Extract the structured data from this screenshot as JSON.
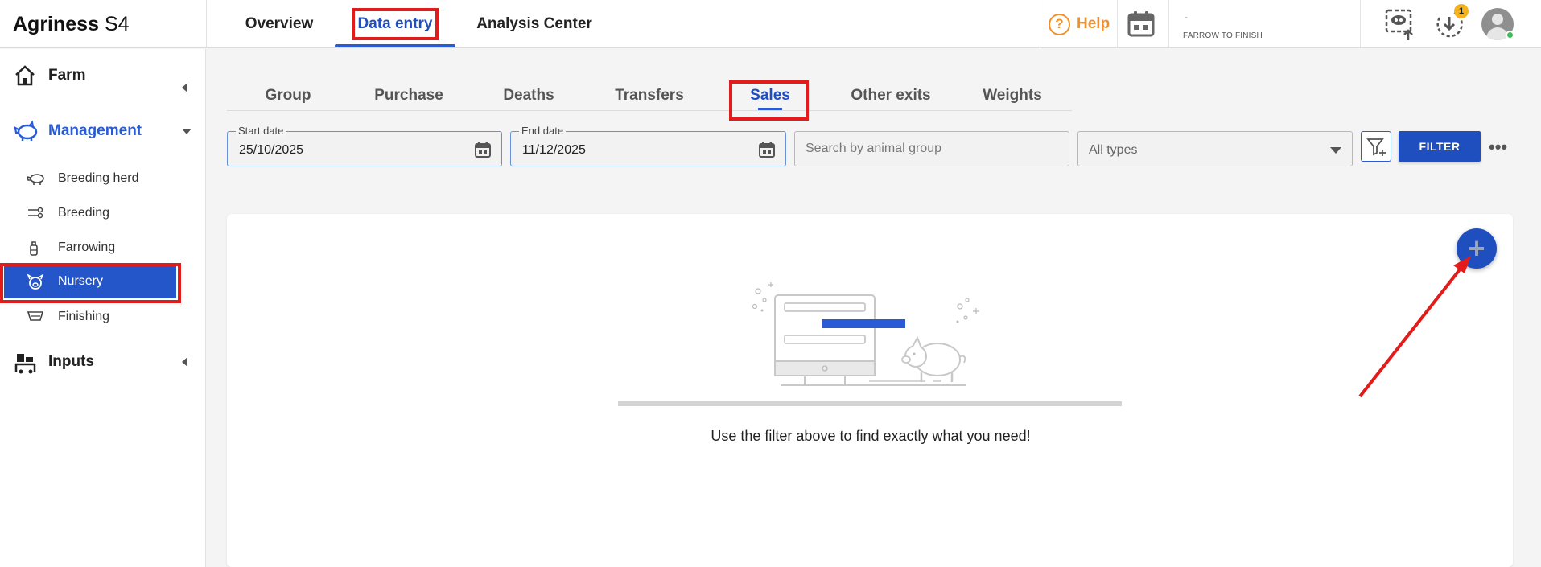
{
  "header": {
    "brand_name": "Agriness",
    "brand_version": "S4",
    "nav": [
      {
        "label": "Overview"
      },
      {
        "label": "Data entry"
      },
      {
        "label": "Analysis Center"
      }
    ],
    "help_label": "Help",
    "farm_name": "-",
    "farm_mode": "FARROW TO FINISH",
    "notification_count": "1",
    "icons": [
      "help-icon",
      "calendar-icon",
      "screen-share-icon",
      "download-icon",
      "avatar"
    ]
  },
  "sidebar": {
    "sections": [
      {
        "label": "Farm",
        "icon": "home-icon"
      },
      {
        "label": "Management",
        "icon": "pig-icon"
      },
      {
        "label": "Inputs",
        "icon": "cart-icon"
      }
    ],
    "items": [
      {
        "label": "Breeding herd",
        "icon": "sow-icon"
      },
      {
        "label": "Breeding",
        "icon": "breeding-icon"
      },
      {
        "label": "Farrowing",
        "icon": "bottle-icon"
      },
      {
        "label": "Nursery",
        "icon": "piglet-icon"
      },
      {
        "label": "Finishing",
        "icon": "feeder-icon"
      }
    ]
  },
  "subtabs": [
    {
      "label": "Group"
    },
    {
      "label": "Purchase"
    },
    {
      "label": "Deaths"
    },
    {
      "label": "Transfers"
    },
    {
      "label": "Sales"
    },
    {
      "label": "Other exits"
    },
    {
      "label": "Weights"
    }
  ],
  "filters": {
    "start_date_label": "Start date",
    "start_date_value": "25/10/2025",
    "end_date_label": "End date",
    "end_date_value": "11/12/2025",
    "search_placeholder": "Search by animal group",
    "type_selected": "All types",
    "filter_button": "FILTER",
    "more_label": "•••"
  },
  "empty_state": {
    "message": "Use the filter above to find exactly what you need!",
    "add_label": "+"
  },
  "colors": {
    "accent": "#1f4fbf",
    "help": "#f0902a",
    "highlight": "#e21b1b",
    "badge": "#f5b21c"
  }
}
